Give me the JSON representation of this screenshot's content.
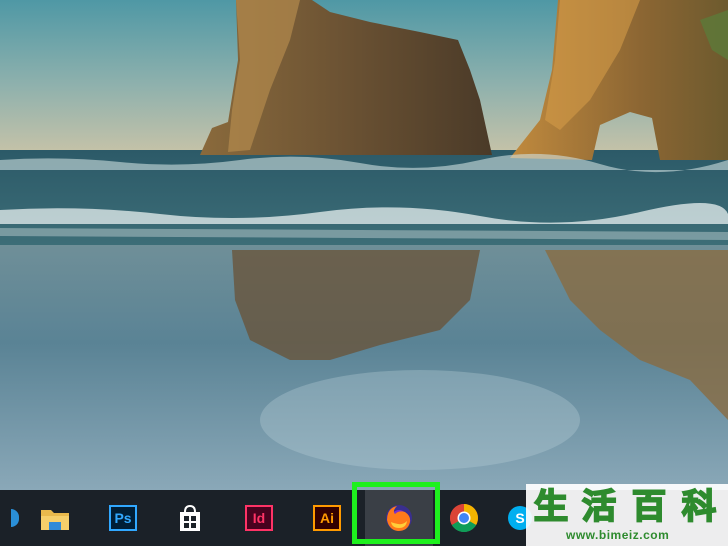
{
  "taskbar": {
    "apps": [
      {
        "id": "file-explorer",
        "icon": "folder-icon"
      },
      {
        "id": "photoshop",
        "label": "Ps",
        "icon": "photoshop-icon"
      },
      {
        "id": "store",
        "icon": "store-bag-icon"
      },
      {
        "id": "indesign",
        "label": "Id",
        "icon": "indesign-icon"
      },
      {
        "id": "illustrator",
        "label": "Ai",
        "icon": "illustrator-icon"
      },
      {
        "id": "firefox",
        "icon": "firefox-icon",
        "active": true,
        "highlighted": true
      },
      {
        "id": "chrome",
        "icon": "chrome-icon"
      },
      {
        "id": "skype",
        "icon": "skype-icon"
      }
    ],
    "highlight_color": "#1ef01e"
  },
  "watermark": {
    "chars": [
      "生",
      "活",
      "百",
      "科"
    ],
    "url": "www.bimeiz.com",
    "color": "#2e8b2e"
  },
  "wallpaper": {
    "scene": "beach-sea-arch"
  }
}
